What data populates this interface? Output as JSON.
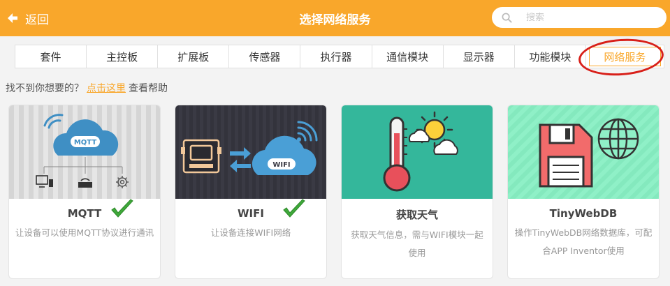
{
  "header": {
    "back_label": "返回",
    "title": "选择网络服务",
    "search_placeholder": "搜索"
  },
  "tabs": [
    {
      "label": "套件"
    },
    {
      "label": "主控板"
    },
    {
      "label": "扩展板"
    },
    {
      "label": "传感器"
    },
    {
      "label": "执行器"
    },
    {
      "label": "通信模块"
    },
    {
      "label": "显示器"
    },
    {
      "label": "功能模块"
    },
    {
      "label": "网络服务",
      "active": true
    }
  ],
  "hint": {
    "prefix": "找不到你想要的？",
    "link": "点击这里",
    "suffix": "查看帮助"
  },
  "cards": [
    {
      "name": "MQTT",
      "desc": "让设备可以使用MQTT协议进行通讯",
      "image_text": "MQTT",
      "checked": true
    },
    {
      "name": "WIFI",
      "desc": "让设备连接WIFI网络",
      "image_text": "WIFI",
      "checked": true
    },
    {
      "name": "获取天气",
      "desc": "获取天气信息，需与WIFI模块一起使用",
      "checked": false
    },
    {
      "name": "TinyWebDB",
      "desc": "操作TinyWebDB网络数据库，可配合APP Inventor使用",
      "checked": false
    }
  ],
  "colors": {
    "accent": "#f9a72b",
    "highlight_ring": "#d8201a",
    "check": "#3fa83a"
  }
}
